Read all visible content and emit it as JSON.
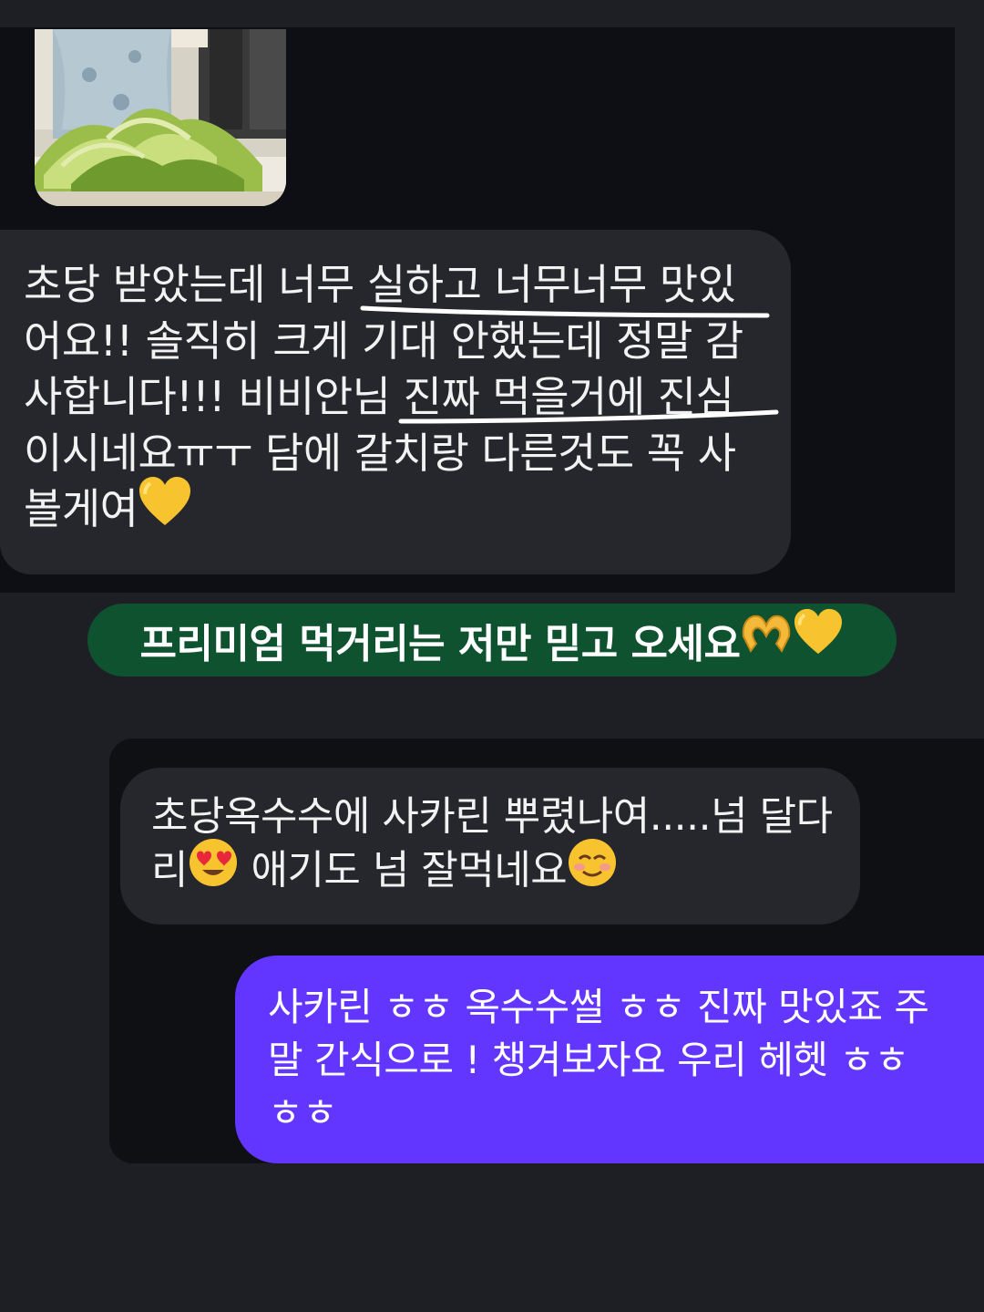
{
  "photo": {
    "alt_icon": "corn-photo"
  },
  "review": {
    "lines": [
      "초당 받았는데 너무 실하고 너무너무 맛있",
      "어요!! 솔직히 크게 기대 안했는데 정말 감",
      "사합니다!!! 비비안님 진짜 먹을거에 진심",
      "이시네요ㅠㅜ 담에 갈치랑 다른것도 꼭 사",
      "볼게여"
    ],
    "heart_icon": "yellow-heart-icon"
  },
  "banner": {
    "text": "프리미엄 먹거리는 저만 믿고 오세요",
    "icons": [
      "heart-hands-icon",
      "yellow-heart-icon"
    ]
  },
  "incoming": {
    "line1": "초당옥수수에 사카린 뿌렸나여.....넘 달다",
    "line2a": "리",
    "line2b": " 애기도 넘 잘먹네요",
    "icons": [
      "heart-eyes-icon",
      "smiling-face-icon"
    ]
  },
  "outgoing": {
    "lines": [
      "사카린 ㅎㅎ 옥수수썰 ㅎㅎ 진짜 맛있죠 주",
      "말 간식으로 ! 챙겨보자요 우리 헤헷 ㅎㅎ",
      "ㅎㅎ"
    ]
  },
  "colors": {
    "background": "#1e1f24",
    "bubble_grey": "#26272d",
    "banner_green": "#0e5230",
    "bubble_purple": "#6236ff"
  }
}
